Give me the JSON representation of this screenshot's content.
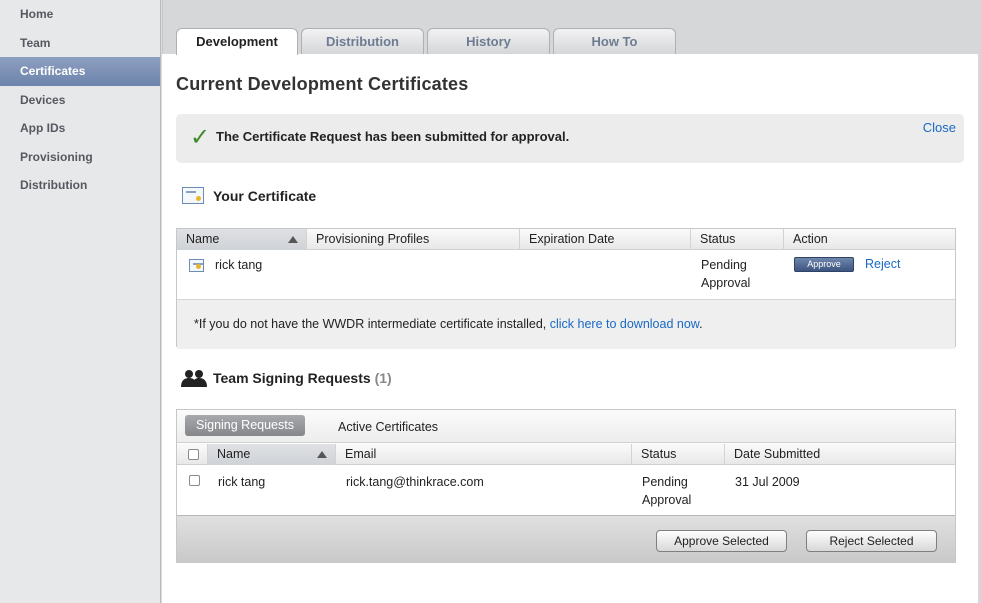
{
  "sidebar": {
    "items": [
      {
        "label": "Home"
      },
      {
        "label": "Team"
      },
      {
        "label": "Certificates"
      },
      {
        "label": "Devices"
      },
      {
        "label": "App IDs"
      },
      {
        "label": "Provisioning"
      },
      {
        "label": "Distribution"
      }
    ],
    "active_index": 2
  },
  "tabs": [
    {
      "label": "Development"
    },
    {
      "label": "Distribution"
    },
    {
      "label": "History"
    },
    {
      "label": "How To"
    }
  ],
  "page_title": "Current Development Certificates",
  "notice": {
    "icon": "checkmark-icon",
    "message": "The Certificate Request has been submitted for approval.",
    "close_label": "Close"
  },
  "your_certificate": {
    "heading": "Your Certificate",
    "columns": [
      "Name",
      "Provisioning Profiles",
      "Expiration Date",
      "Status",
      "Action"
    ],
    "rows": [
      {
        "name": "rick tang",
        "provisioning_profiles": "",
        "expiration_date": "",
        "status_line1": "Pending",
        "status_line2": "Approval",
        "approve_label": "Approve",
        "reject_label": "Reject"
      }
    ],
    "wwdr_prefix": "*If you do not have the WWDR intermediate certificate installed, ",
    "wwdr_link": "click here to download now",
    "wwdr_suffix": "."
  },
  "team_signing": {
    "heading": "Team Signing Requests",
    "count": "(1)",
    "subtabs": [
      "Signing Requests",
      "Active Certificates"
    ],
    "columns": [
      "Name",
      "Email",
      "Status",
      "Date Submitted"
    ],
    "rows": [
      {
        "name": "rick tang",
        "email": "rick.tang@thinkrace.com",
        "status_line1": "Pending",
        "status_line2": "Approval",
        "date": "31 Jul 2009"
      }
    ],
    "approve_selected_label": "Approve Selected",
    "reject_selected_label": "Reject Selected"
  },
  "colors": {
    "sidebar_active": "#7a8fb5",
    "link": "#1a69c4",
    "check": "#3e8a2a"
  }
}
